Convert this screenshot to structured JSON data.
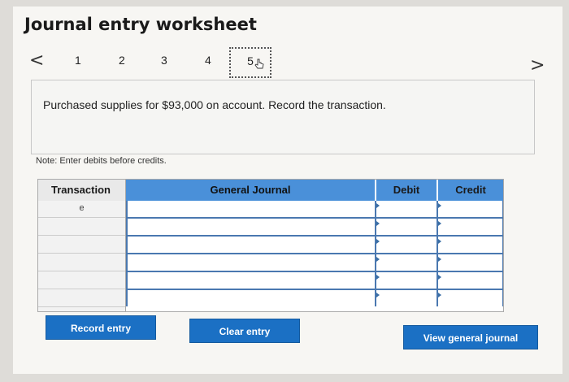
{
  "header": {
    "title": "Journal entry worksheet"
  },
  "pager": {
    "prev": "<",
    "next": ">",
    "pages": [
      {
        "label": "1"
      },
      {
        "label": "2"
      },
      {
        "label": "3"
      },
      {
        "label": "4"
      },
      {
        "label": "5"
      }
    ],
    "active_page": 5
  },
  "question": {
    "text": "Purchased supplies for $93,000 on account. Record the transaction."
  },
  "note": "Note: Enter debits before credits.",
  "grid": {
    "columns": {
      "transaction": "Transaction",
      "general_journal": "General Journal",
      "debit": "Debit",
      "credit": "Credit"
    },
    "transaction_label": "e",
    "accent_color": "#4a90d9"
  },
  "buttons": {
    "record": "Record entry",
    "clear": "Clear entry",
    "view": "View general journal"
  }
}
